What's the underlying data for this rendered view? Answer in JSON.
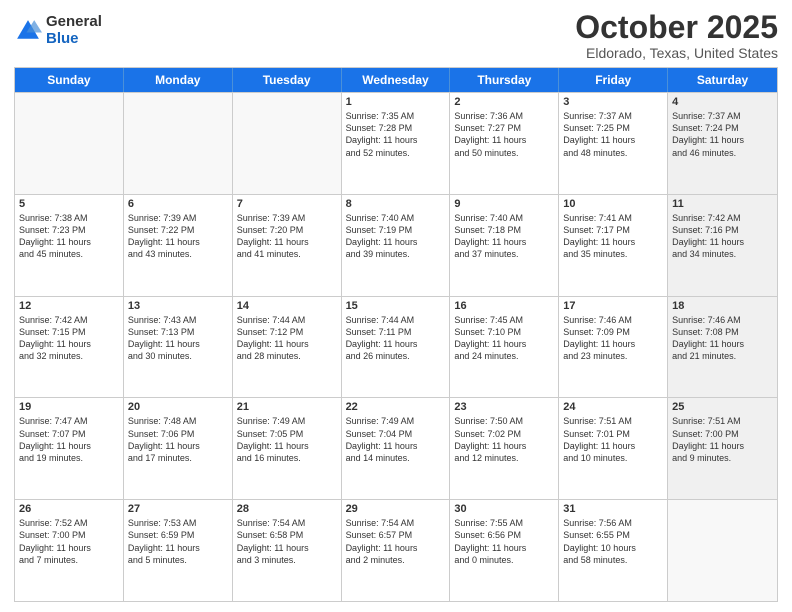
{
  "header": {
    "logo_general": "General",
    "logo_blue": "Blue",
    "month_title": "October 2025",
    "location": "Eldorado, Texas, United States"
  },
  "days_of_week": [
    "Sunday",
    "Monday",
    "Tuesday",
    "Wednesday",
    "Thursday",
    "Friday",
    "Saturday"
  ],
  "weeks": [
    [
      {
        "day": "",
        "info": "",
        "empty": true
      },
      {
        "day": "",
        "info": "",
        "empty": true
      },
      {
        "day": "",
        "info": "",
        "empty": true
      },
      {
        "day": "1",
        "info": "Sunrise: 7:35 AM\nSunset: 7:28 PM\nDaylight: 11 hours\nand 52 minutes.",
        "empty": false
      },
      {
        "day": "2",
        "info": "Sunrise: 7:36 AM\nSunset: 7:27 PM\nDaylight: 11 hours\nand 50 minutes.",
        "empty": false
      },
      {
        "day": "3",
        "info": "Sunrise: 7:37 AM\nSunset: 7:25 PM\nDaylight: 11 hours\nand 48 minutes.",
        "empty": false
      },
      {
        "day": "4",
        "info": "Sunrise: 7:37 AM\nSunset: 7:24 PM\nDaylight: 11 hours\nand 46 minutes.",
        "empty": false,
        "shaded": true
      }
    ],
    [
      {
        "day": "5",
        "info": "Sunrise: 7:38 AM\nSunset: 7:23 PM\nDaylight: 11 hours\nand 45 minutes.",
        "empty": false
      },
      {
        "day": "6",
        "info": "Sunrise: 7:39 AM\nSunset: 7:22 PM\nDaylight: 11 hours\nand 43 minutes.",
        "empty": false
      },
      {
        "day": "7",
        "info": "Sunrise: 7:39 AM\nSunset: 7:20 PM\nDaylight: 11 hours\nand 41 minutes.",
        "empty": false
      },
      {
        "day": "8",
        "info": "Sunrise: 7:40 AM\nSunset: 7:19 PM\nDaylight: 11 hours\nand 39 minutes.",
        "empty": false
      },
      {
        "day": "9",
        "info": "Sunrise: 7:40 AM\nSunset: 7:18 PM\nDaylight: 11 hours\nand 37 minutes.",
        "empty": false
      },
      {
        "day": "10",
        "info": "Sunrise: 7:41 AM\nSunset: 7:17 PM\nDaylight: 11 hours\nand 35 minutes.",
        "empty": false
      },
      {
        "day": "11",
        "info": "Sunrise: 7:42 AM\nSunset: 7:16 PM\nDaylight: 11 hours\nand 34 minutes.",
        "empty": false,
        "shaded": true
      }
    ],
    [
      {
        "day": "12",
        "info": "Sunrise: 7:42 AM\nSunset: 7:15 PM\nDaylight: 11 hours\nand 32 minutes.",
        "empty": false
      },
      {
        "day": "13",
        "info": "Sunrise: 7:43 AM\nSunset: 7:13 PM\nDaylight: 11 hours\nand 30 minutes.",
        "empty": false
      },
      {
        "day": "14",
        "info": "Sunrise: 7:44 AM\nSunset: 7:12 PM\nDaylight: 11 hours\nand 28 minutes.",
        "empty": false
      },
      {
        "day": "15",
        "info": "Sunrise: 7:44 AM\nSunset: 7:11 PM\nDaylight: 11 hours\nand 26 minutes.",
        "empty": false
      },
      {
        "day": "16",
        "info": "Sunrise: 7:45 AM\nSunset: 7:10 PM\nDaylight: 11 hours\nand 24 minutes.",
        "empty": false
      },
      {
        "day": "17",
        "info": "Sunrise: 7:46 AM\nSunset: 7:09 PM\nDaylight: 11 hours\nand 23 minutes.",
        "empty": false
      },
      {
        "day": "18",
        "info": "Sunrise: 7:46 AM\nSunset: 7:08 PM\nDaylight: 11 hours\nand 21 minutes.",
        "empty": false,
        "shaded": true
      }
    ],
    [
      {
        "day": "19",
        "info": "Sunrise: 7:47 AM\nSunset: 7:07 PM\nDaylight: 11 hours\nand 19 minutes.",
        "empty": false
      },
      {
        "day": "20",
        "info": "Sunrise: 7:48 AM\nSunset: 7:06 PM\nDaylight: 11 hours\nand 17 minutes.",
        "empty": false
      },
      {
        "day": "21",
        "info": "Sunrise: 7:49 AM\nSunset: 7:05 PM\nDaylight: 11 hours\nand 16 minutes.",
        "empty": false
      },
      {
        "day": "22",
        "info": "Sunrise: 7:49 AM\nSunset: 7:04 PM\nDaylight: 11 hours\nand 14 minutes.",
        "empty": false
      },
      {
        "day": "23",
        "info": "Sunrise: 7:50 AM\nSunset: 7:02 PM\nDaylight: 11 hours\nand 12 minutes.",
        "empty": false
      },
      {
        "day": "24",
        "info": "Sunrise: 7:51 AM\nSunset: 7:01 PM\nDaylight: 11 hours\nand 10 minutes.",
        "empty": false
      },
      {
        "day": "25",
        "info": "Sunrise: 7:51 AM\nSunset: 7:00 PM\nDaylight: 11 hours\nand 9 minutes.",
        "empty": false,
        "shaded": true
      }
    ],
    [
      {
        "day": "26",
        "info": "Sunrise: 7:52 AM\nSunset: 7:00 PM\nDaylight: 11 hours\nand 7 minutes.",
        "empty": false
      },
      {
        "day": "27",
        "info": "Sunrise: 7:53 AM\nSunset: 6:59 PM\nDaylight: 11 hours\nand 5 minutes.",
        "empty": false
      },
      {
        "day": "28",
        "info": "Sunrise: 7:54 AM\nSunset: 6:58 PM\nDaylight: 11 hours\nand 3 minutes.",
        "empty": false
      },
      {
        "day": "29",
        "info": "Sunrise: 7:54 AM\nSunset: 6:57 PM\nDaylight: 11 hours\nand 2 minutes.",
        "empty": false
      },
      {
        "day": "30",
        "info": "Sunrise: 7:55 AM\nSunset: 6:56 PM\nDaylight: 11 hours\nand 0 minutes.",
        "empty": false
      },
      {
        "day": "31",
        "info": "Sunrise: 7:56 AM\nSunset: 6:55 PM\nDaylight: 10 hours\nand 58 minutes.",
        "empty": false
      },
      {
        "day": "",
        "info": "",
        "empty": true,
        "shaded": true
      }
    ]
  ]
}
